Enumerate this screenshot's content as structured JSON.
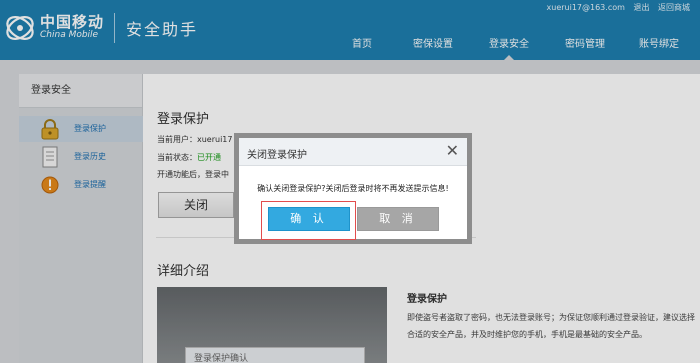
{
  "brand": {
    "name_cn": "中国移动",
    "name_en": "China Mobile",
    "app_title": "安全助手"
  },
  "userbar": {
    "email": "xuerui17@163.com",
    "logout": "退出",
    "back_to_mail": "返回商城"
  },
  "nav": {
    "items": [
      {
        "label": "首页"
      },
      {
        "label": "密保设置"
      },
      {
        "label": "登录安全"
      },
      {
        "label": "密码管理"
      },
      {
        "label": "账号绑定"
      }
    ],
    "active": "登录安全"
  },
  "sidebar": {
    "title": "登录安全",
    "items": [
      {
        "label": "登录保护",
        "icon": "lock-icon"
      },
      {
        "label": "登录历史",
        "icon": "history-document-icon"
      },
      {
        "label": "登录提醒",
        "icon": "alert-icon"
      }
    ]
  },
  "main": {
    "section_title": "登录保护",
    "current_user_label": "当前用户：xuerui17",
    "current_status_label": "当前状态：",
    "current_status_value": "已开通",
    "note": "开通功能后，登录中",
    "close_button": "关闭",
    "detail_title": "详细介绍",
    "preview_label": "登录保护确认",
    "feature_title": "登录保护",
    "feature_desc": "即使盗号者盗取了密码，也无法登录账号；为保证您顺利通过登录验证，建议选择合适的安全产品，并及时维护您的手机，手机是最基础的安全产品。"
  },
  "modal": {
    "title": "关闭登录保护",
    "message": "确认关闭登录保护?关闭后登录时将不再发送提示信息!",
    "confirm": "确 认",
    "cancel": "取 消"
  },
  "colors": {
    "header_bg": "#1e7fb0",
    "confirm_bg": "#33a9e0",
    "cancel_bg": "#a6a6a6",
    "status_green": "#1fa01f",
    "highlight_red": "#e24d4d"
  }
}
